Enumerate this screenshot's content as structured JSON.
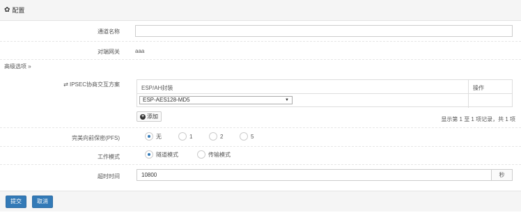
{
  "panel": {
    "title": "配置"
  },
  "form": {
    "tunnel_name": {
      "label": "通道名称",
      "value": ""
    },
    "peer_gateway": {
      "label": "对端网关",
      "value": "aaa"
    },
    "advanced_toggle": "高级选项 »",
    "ipsec": {
      "label": "⇄ IPSEC协商交互方案",
      "columns": [
        "ESP/AH封装",
        "操作"
      ],
      "selected": "ESP-AES128-MD5",
      "add_label": "添加",
      "pager_info": "显示第 1 至 1 项记录，共 1 项"
    },
    "pfs": {
      "label": "完美向前保密(PFS)",
      "options": [
        "无",
        "1",
        "2",
        "5"
      ],
      "selected": "无"
    },
    "work_mode": {
      "label": "工作模式",
      "options": [
        "隧道模式",
        "传输模式"
      ],
      "selected": "隧道模式"
    },
    "timeout": {
      "label": "超时时间",
      "value": "10800",
      "unit": "秒"
    }
  },
  "footer": {
    "submit_label": "提交",
    "cancel_label": "取消"
  },
  "colors": {
    "primary": "#337ab7"
  }
}
